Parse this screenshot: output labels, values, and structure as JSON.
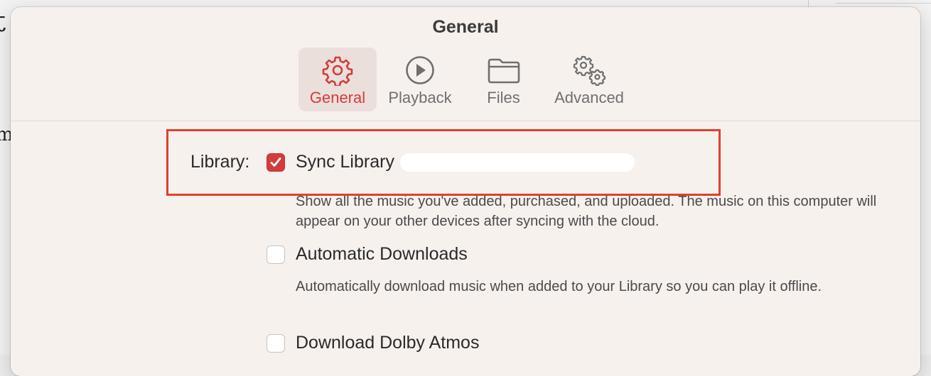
{
  "window": {
    "title": "General"
  },
  "tabs": [
    {
      "label": "General",
      "icon": "gear-icon",
      "active": true
    },
    {
      "label": "Playback",
      "icon": "play-circle-icon",
      "active": false
    },
    {
      "label": "Files",
      "icon": "folder-icon",
      "active": false
    },
    {
      "label": "Advanced",
      "icon": "gears-icon",
      "active": false
    }
  ],
  "library": {
    "label": "Library:",
    "sync": {
      "label": "Sync Library",
      "checked": true,
      "description": "Show all the music you've added, purchased, and uploaded. The music on this computer will appear on your other devices after syncing with the cloud."
    },
    "auto_downloads": {
      "label": "Automatic Downloads",
      "checked": false,
      "description": "Automatically download music when added to your Library so you can play it offline."
    },
    "dolby": {
      "label": "Download Dolby Atmos",
      "checked": false
    }
  },
  "colors": {
    "accent": "#d33c3c",
    "highlight": "#e0412b",
    "window_bg": "#f7f1ee"
  }
}
